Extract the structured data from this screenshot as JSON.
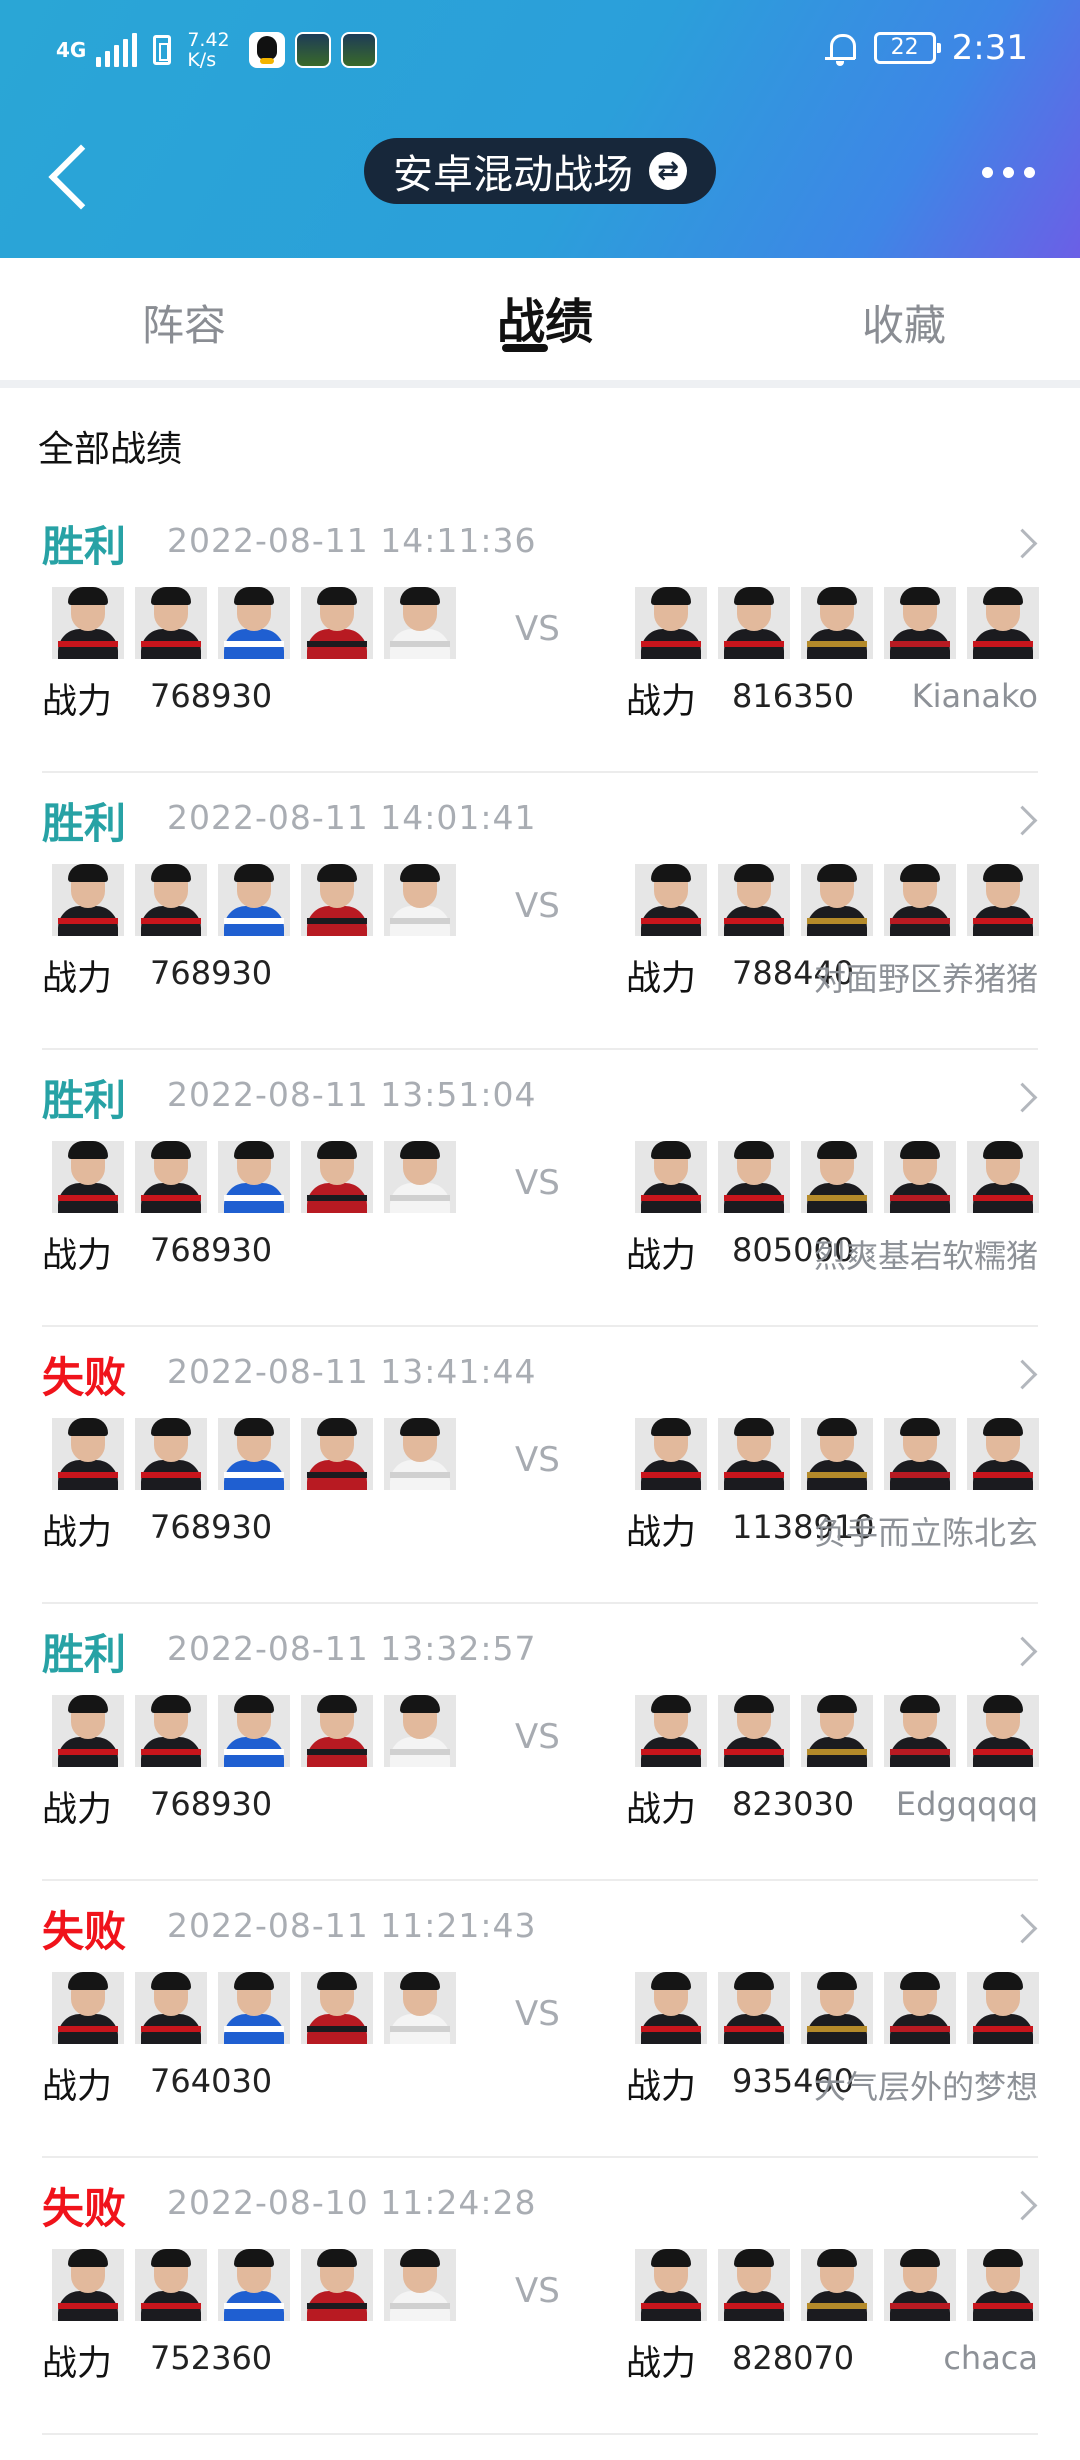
{
  "status_bar": {
    "network": "4G",
    "speed_value": "7.42",
    "speed_unit": "K/s",
    "battery": "22",
    "time": "2:31"
  },
  "nav": {
    "title": "安卓混动战场"
  },
  "tabs": [
    {
      "label": "阵容"
    },
    {
      "label": "战绩"
    },
    {
      "label": "收藏"
    }
  ],
  "section_title": "全部战绩",
  "power_label": "战力",
  "vs_label": "VS",
  "colors": {
    "win": "#27a2a5",
    "lose": "#f0131b"
  },
  "matches": [
    {
      "result": "胜利",
      "outcome": "win",
      "time": "2022-08-11 14:11:36",
      "my_power": "768930",
      "opp_power": "816350",
      "opp_name": "Kianako"
    },
    {
      "result": "胜利",
      "outcome": "win",
      "time": "2022-08-11 14:01:41",
      "my_power": "768930",
      "opp_power": "788440",
      "opp_name": "对面野区养猪猪"
    },
    {
      "result": "胜利",
      "outcome": "win",
      "time": "2022-08-11 13:51:04",
      "my_power": "768930",
      "opp_power": "805000",
      "opp_name": "烈爽基岩软糯猪"
    },
    {
      "result": "失败",
      "outcome": "lose",
      "time": "2022-08-11 13:41:44",
      "my_power": "768930",
      "opp_power": "1138910",
      "opp_name": "负手而立陈北玄"
    },
    {
      "result": "胜利",
      "outcome": "win",
      "time": "2022-08-11 13:32:57",
      "my_power": "768930",
      "opp_power": "823030",
      "opp_name": "Edgqqqq"
    },
    {
      "result": "失败",
      "outcome": "lose",
      "time": "2022-08-11 11:21:43",
      "my_power": "764030",
      "opp_power": "935460",
      "opp_name": "大气层外的梦想"
    },
    {
      "result": "失败",
      "outcome": "lose",
      "time": "2022-08-10 11:24:28",
      "my_power": "752360",
      "opp_power": "828070",
      "opp_name": "chaca"
    }
  ]
}
